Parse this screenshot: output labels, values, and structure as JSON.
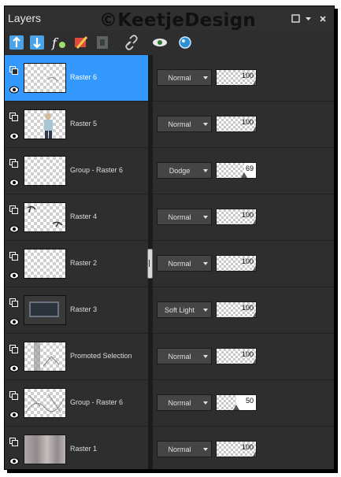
{
  "panel": {
    "title": "Layers",
    "watermark": "©KeetjeDesign"
  },
  "toolbar": {
    "icons": [
      "new-raster-layer-icon",
      "merge-down-icon",
      "layer-effects-icon",
      "paint-brush-icon",
      "mask-icon",
      "link-icon",
      "visibility-eye-icon",
      "layer-style-icon"
    ]
  },
  "layers": [
    {
      "name": "Raster 6",
      "blend": "Normal",
      "opacity": "100",
      "opacity_level": 1.0,
      "selected": true,
      "thumb": "transparent-sketch"
    },
    {
      "name": "Raster 5",
      "blend": "Normal",
      "opacity": "100",
      "opacity_level": 1.0,
      "selected": false,
      "thumb": "person"
    },
    {
      "name": "Group - Raster 6",
      "blend": "Dodge",
      "opacity": "69",
      "opacity_level": 0.69,
      "selected": false,
      "thumb": "empty"
    },
    {
      "name": "Raster 4",
      "blend": "Normal",
      "opacity": "100",
      "opacity_level": 1.0,
      "selected": false,
      "thumb": "text-art"
    },
    {
      "name": "Raster 2",
      "blend": "Normal",
      "opacity": "100",
      "opacity_level": 1.0,
      "selected": false,
      "thumb": "empty"
    },
    {
      "name": "Raster 3",
      "blend": "Soft Light",
      "opacity": "100",
      "opacity_level": 1.0,
      "selected": false,
      "thumb": "dark-frame"
    },
    {
      "name": "Promoted Selection",
      "blend": "Normal",
      "opacity": "100",
      "opacity_level": 1.0,
      "selected": false,
      "thumb": "gray-texture"
    },
    {
      "name": "Group - Raster 6",
      "blend": "Normal",
      "opacity": "50",
      "opacity_level": 0.5,
      "selected": false,
      "thumb": "sketch"
    },
    {
      "name": "Raster 1",
      "blend": "Normal",
      "opacity": "100",
      "opacity_level": 1.0,
      "selected": false,
      "thumb": "blurred"
    }
  ],
  "colors": {
    "selected": "#3399ff",
    "panel_bg": "#2e2e2e"
  }
}
